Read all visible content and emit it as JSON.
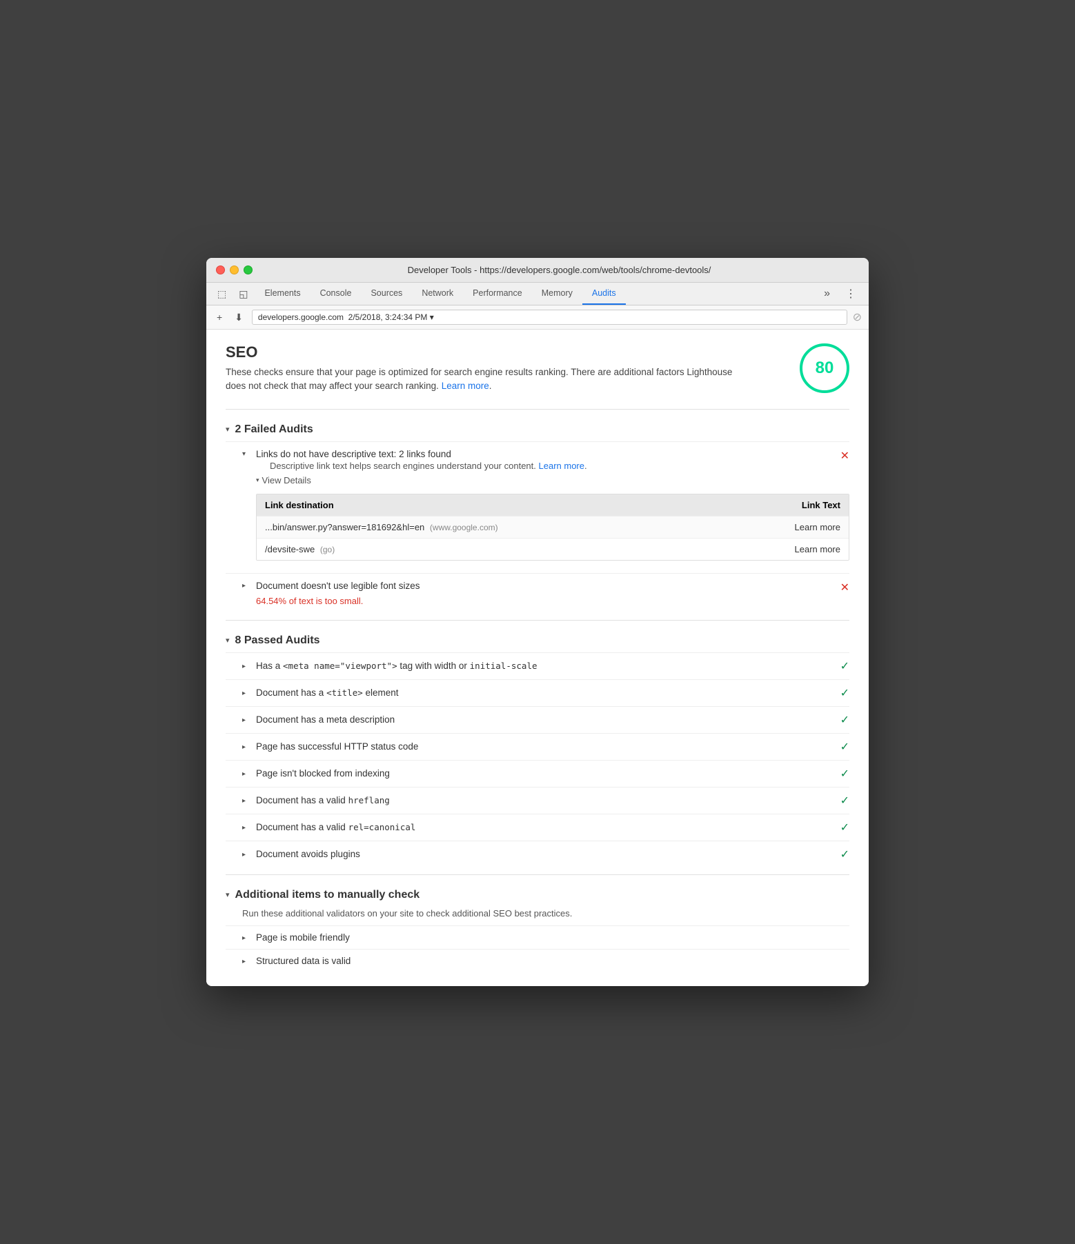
{
  "window": {
    "title": "Developer Tools - https://developers.google.com/web/tools/chrome-devtools/"
  },
  "traffic_lights": {
    "red": "close",
    "yellow": "minimize",
    "green": "maximize"
  },
  "tabs": [
    {
      "id": "elements",
      "label": "Elements",
      "active": false
    },
    {
      "id": "console",
      "label": "Console",
      "active": false
    },
    {
      "id": "sources",
      "label": "Sources",
      "active": false
    },
    {
      "id": "network",
      "label": "Network",
      "active": false
    },
    {
      "id": "performance",
      "label": "Performance",
      "active": false
    },
    {
      "id": "memory",
      "label": "Memory",
      "active": false
    },
    {
      "id": "audits",
      "label": "Audits",
      "active": true
    }
  ],
  "address_bar": {
    "value": "developers.google.com  2/5/2018, 3:24:34 PM ▾"
  },
  "seo": {
    "title": "SEO",
    "description": "These checks ensure that your page is optimized for search engine results ranking. There are additional factors Lighthouse does not check that may affect your search ranking.",
    "learn_more": "Learn more",
    "score": "80"
  },
  "failed_audits": {
    "heading": "2 Failed Audits",
    "items": [
      {
        "id": "links-descriptive",
        "title": "Links do not have descriptive text: 2 links found",
        "subtitle": "Descriptive link text helps search engines understand your content.",
        "subtitle_link": "Learn more",
        "status": "fail",
        "expanded": true,
        "view_details": "View Details",
        "table": {
          "headers": [
            "Link destination",
            "Link Text"
          ],
          "rows": [
            {
              "dest": "...bin/answer.py?answer=181692&hl=en",
              "dest_domain": "(www.google.com)",
              "link_text": "Learn more"
            },
            {
              "dest": "/devsite-swe",
              "dest_domain": "(go)",
              "link_text": "Learn more"
            }
          ]
        }
      },
      {
        "id": "font-sizes",
        "title": "Document doesn't use legible font sizes",
        "failed_text": "64.54% of text is too small.",
        "status": "fail",
        "expanded": false
      }
    ]
  },
  "passed_audits": {
    "heading": "8 Passed Audits",
    "items": [
      {
        "id": "viewport",
        "title_parts": [
          "Has a ",
          "<meta name=\"viewport\">",
          " tag with width or ",
          "initial-scale"
        ],
        "title_html": true,
        "title": "Has a <meta name=\"viewport\"> tag with width or initial-scale",
        "status": "pass"
      },
      {
        "id": "title",
        "title": "Document has a <title> element",
        "status": "pass"
      },
      {
        "id": "meta-desc",
        "title": "Document has a meta description",
        "status": "pass"
      },
      {
        "id": "http-status",
        "title": "Page has successful HTTP status code",
        "status": "pass"
      },
      {
        "id": "indexing",
        "title": "Page isn't blocked from indexing",
        "status": "pass"
      },
      {
        "id": "hreflang",
        "title": "Document has a valid hreflang",
        "status": "pass"
      },
      {
        "id": "canonical",
        "title": "Document has a valid rel=canonical",
        "status": "pass"
      },
      {
        "id": "plugins",
        "title": "Document avoids plugins",
        "status": "pass"
      }
    ]
  },
  "additional_items": {
    "heading": "Additional items to manually check",
    "description": "Run these additional validators on your site to check additional SEO best practices.",
    "items": [
      {
        "id": "mobile-friendly",
        "title": "Page is mobile friendly"
      },
      {
        "id": "structured-data",
        "title": "Structured data is valid"
      }
    ]
  },
  "icons": {
    "chevron_down": "▾",
    "chevron_right": "▸",
    "x_mark": "✕",
    "check_mark": "✓",
    "cursor_icon": "⬚",
    "device_icon": "◱",
    "plus_icon": "+",
    "download_icon": "⬇",
    "more_tabs": "»",
    "menu": "⋮",
    "stop": "⊘"
  }
}
